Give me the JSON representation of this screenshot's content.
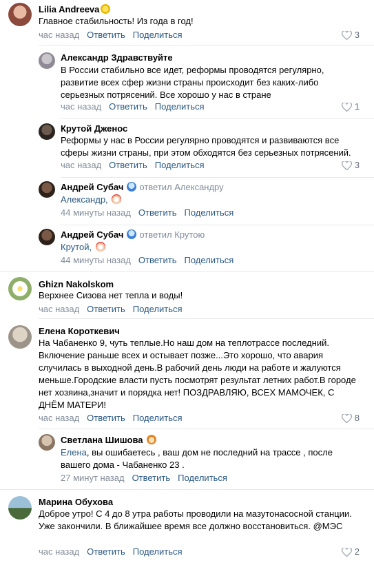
{
  "comments": [
    {
      "name": "Lilia Andreeva",
      "text": "Главное стабильность! Из года в год!",
      "time": "час назад",
      "reply": "Ответить",
      "share": "Поделиться",
      "likes": "3"
    },
    {
      "name": "Александр Здравствуйте",
      "text": "В России стабильно все идет, реформы проводятся регулярно, развитие всех сфер жизни страны происходит без каких-либо серьезных потрясений. Все хорошо у нас в стране",
      "time": "час назад",
      "reply": "Ответить",
      "share": "Поделиться",
      "likes": "1"
    },
    {
      "name": "Крутой Дженос",
      "text": "Реформы у нас в России регулярно проводятся и развиваются все сферы жизни страны, при этом обходятся без серьезных потрясений.",
      "time": "час назад",
      "reply": "Ответить",
      "share": "Поделиться",
      "likes": "3"
    },
    {
      "name": "Андрей Субач",
      "replied": "ответил Александру",
      "link": "Александр,",
      "time": "44 минуты назад",
      "reply": "Ответить",
      "share": "Поделиться"
    },
    {
      "name": "Андрей Субач",
      "replied": "ответил Крутою",
      "link": "Крутой,",
      "time": "44 минуты назад",
      "reply": "Ответить",
      "share": "Поделиться"
    },
    {
      "name": "Ghizn Nakolskom",
      "text": "Верхнее Сизова нет тепла и воды!",
      "time": "час назад",
      "reply": "Ответить",
      "share": "Поделиться"
    },
    {
      "name": "Елена Короткевич",
      "text": "На Чабаненко 9, чуть теплые.Но наш дом на теплотрассе последний. Включение раньше всех и остывает позже...Это хорошо, что авария случилась в выходной день.В рабочий день люди на работе и жалуются меньше.Городские власти пусть посмотрят результат летних работ.В городе нет хозяина,значит и порядка нет! ПОЗДРАВЛЯЮ, ВСЕХ МАМОЧЕК, С ДНЁМ МАТЕРИ!",
      "time": "час назад",
      "reply": "Ответить",
      "share": "Поделиться",
      "likes": "8"
    },
    {
      "name": "Светлана Шишова",
      "link": "Елена",
      "text": ", вы ошибаетесь , ваш дом не последний на трассе , после вашего дома - Чабаненко 23 .",
      "time": "27 минут назад",
      "reply": "Ответить",
      "share": "Поделиться"
    },
    {
      "name": "Марина Обухова",
      "text": "Доброе утро! С 4 до 8 утра работы проводили на мазутонасосной станции. Уже закончили. В ближайшее время все должно восстановиться. @МЭС",
      "time": "час назад",
      "reply": "Ответить",
      "share": "Поделиться",
      "likes": "2"
    }
  ],
  "icons": {
    "like": "heart-outline-icon"
  },
  "colors": {
    "link": "#2a5885",
    "meta": "#818c99"
  }
}
